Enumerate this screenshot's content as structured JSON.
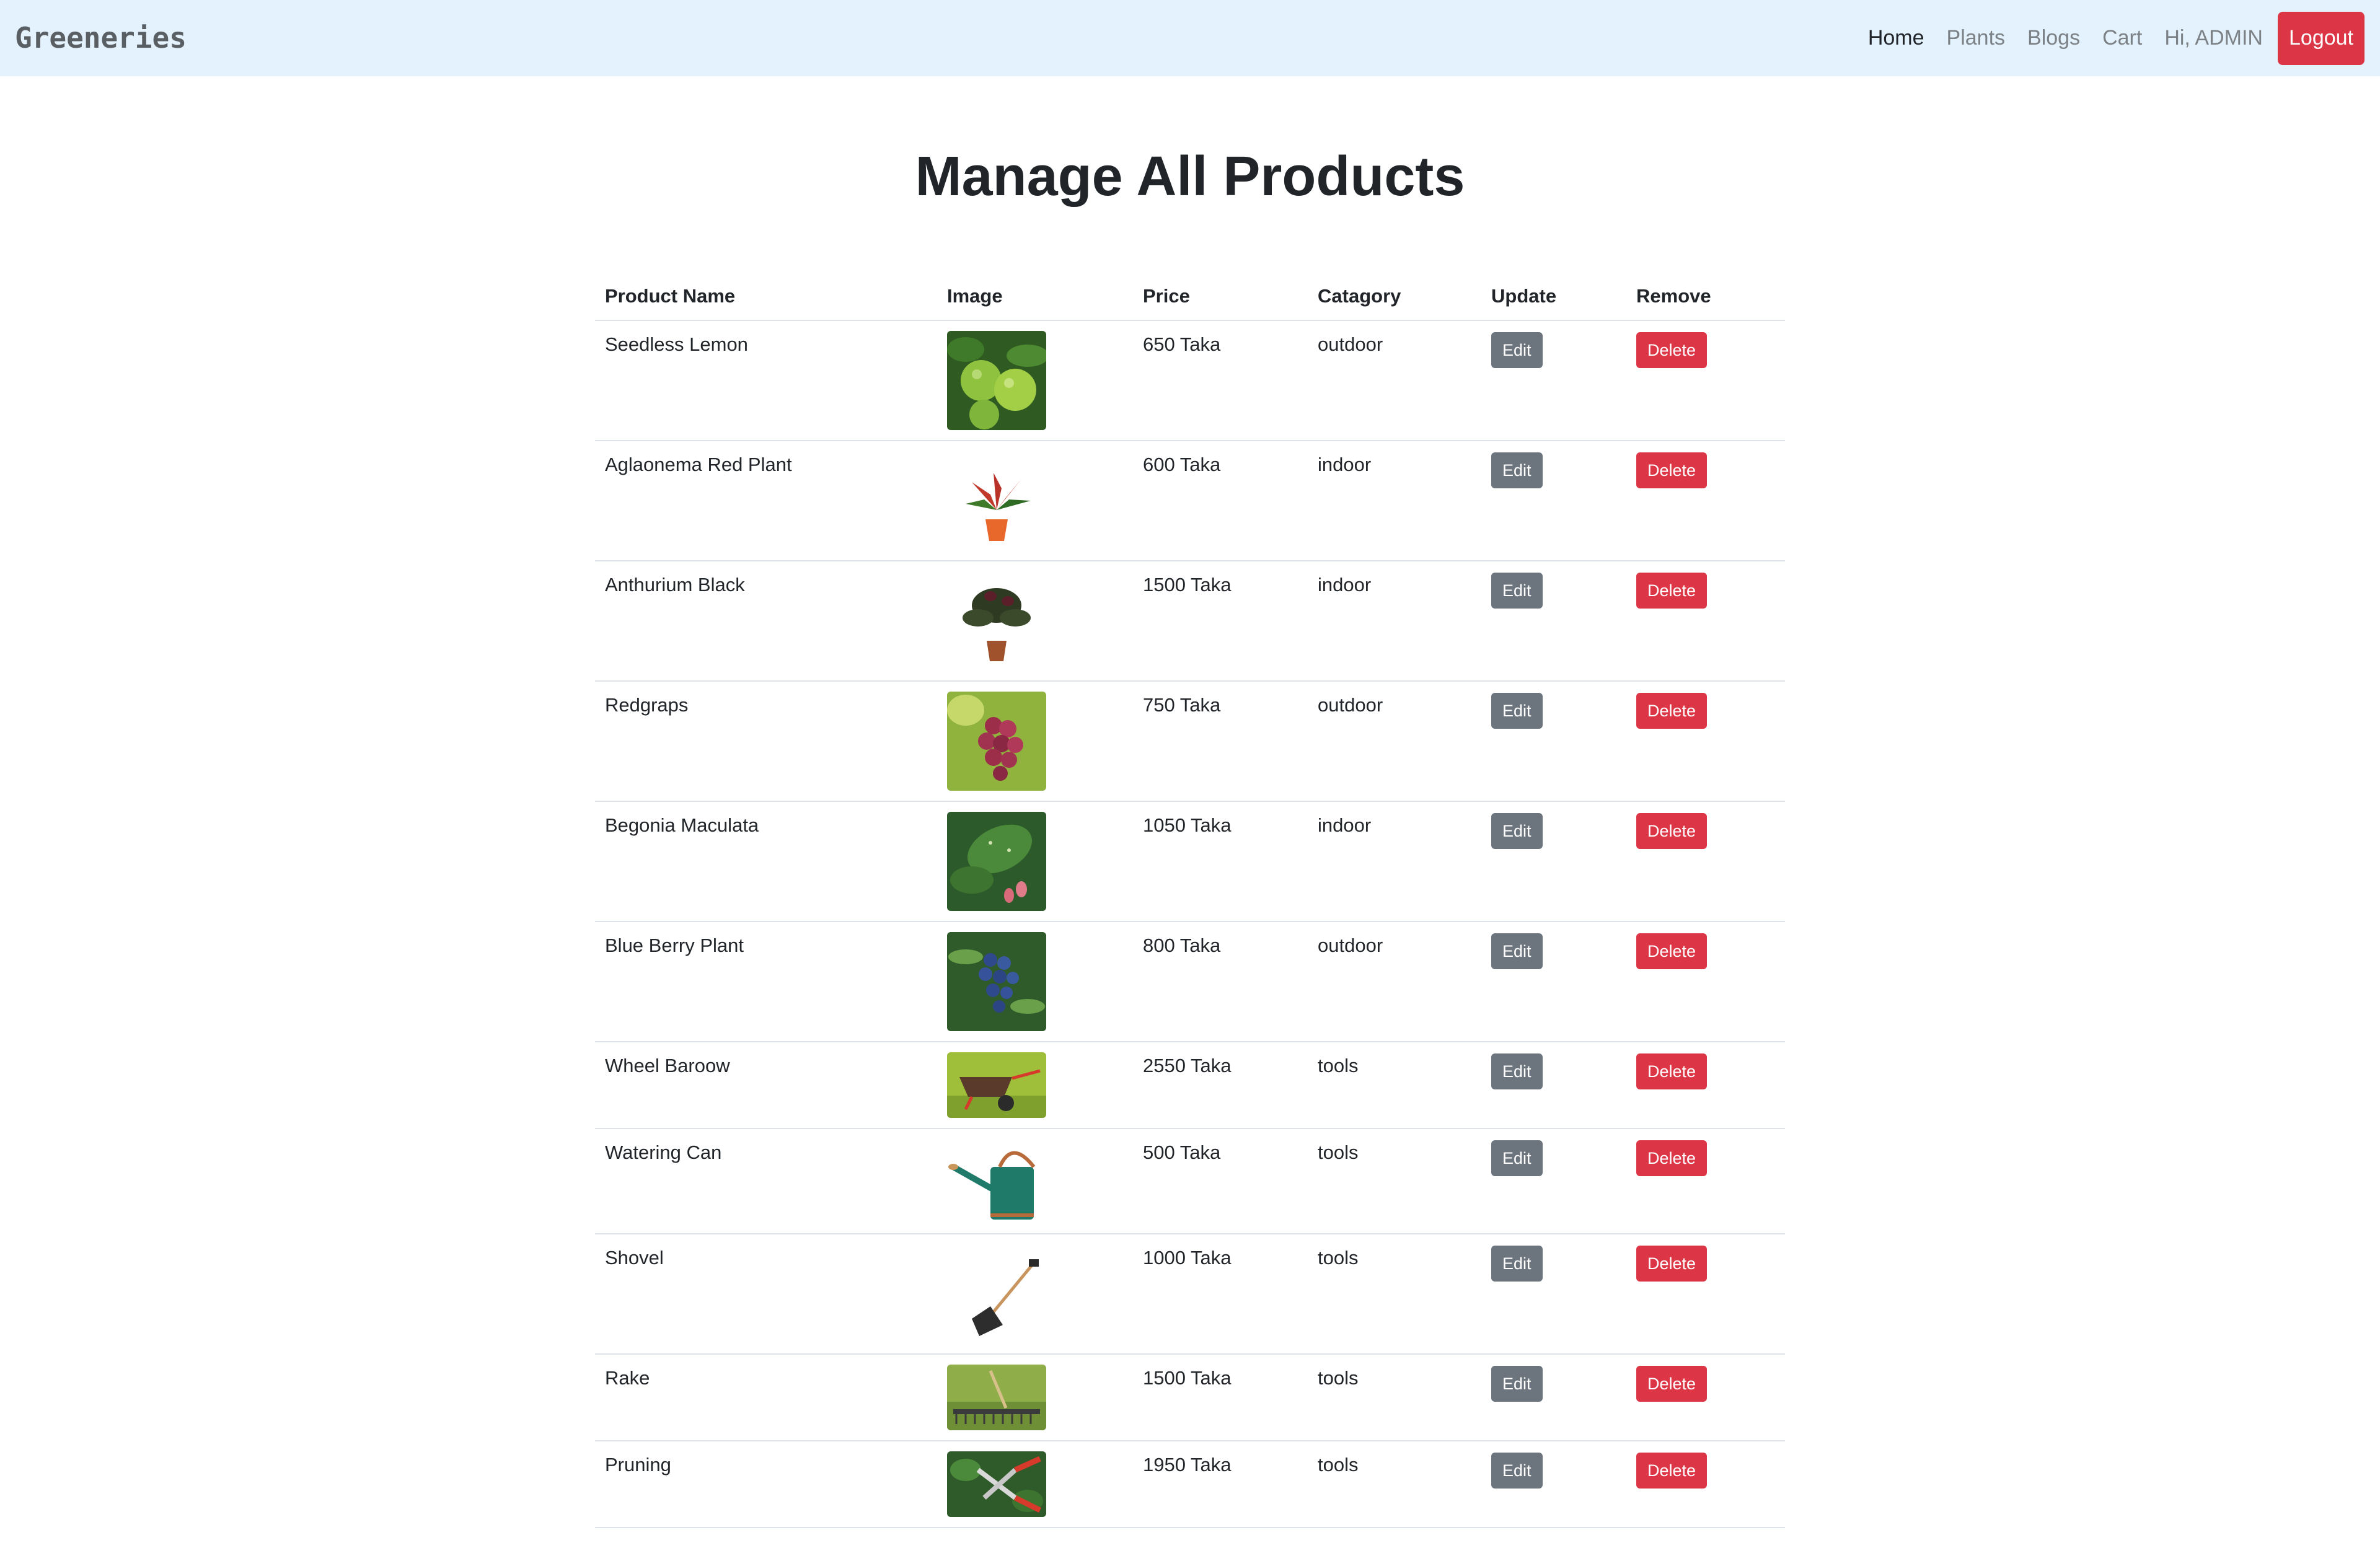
{
  "navbar": {
    "brand": "Greeneries",
    "links": [
      "Home",
      "Plants",
      "Blogs",
      "Cart",
      "Hi, ADMIN"
    ],
    "logout_label": "Logout"
  },
  "page": {
    "title": "Manage All Products"
  },
  "table": {
    "headers": [
      "Product Name",
      "Image",
      "Price",
      "Catagory",
      "Update",
      "Remove"
    ],
    "edit_label": "Edit",
    "delete_label": "Delete",
    "rows": [
      {
        "name": "Seedless Lemon",
        "price": "650 Taka",
        "category": "outdoor",
        "image": "lemon-image"
      },
      {
        "name": "Aglaonema Red Plant",
        "price": "600 Taka",
        "category": "indoor",
        "image": "aglaonema-image"
      },
      {
        "name": "Anthurium Black",
        "price": "1500 Taka",
        "category": "indoor",
        "image": "anthurium-image"
      },
      {
        "name": "Redgraps",
        "price": "750 Taka",
        "category": "outdoor",
        "image": "grapes-image"
      },
      {
        "name": "Begonia Maculata",
        "price": "1050 Taka",
        "category": "indoor",
        "image": "begonia-image"
      },
      {
        "name": "Blue Berry Plant",
        "price": "800 Taka",
        "category": "outdoor",
        "image": "blueberry-image"
      },
      {
        "name": "Wheel Baroow",
        "price": "2550 Taka",
        "category": "tools",
        "image": "wheelbarrow-image"
      },
      {
        "name": "Watering Can",
        "price": "500 Taka",
        "category": "tools",
        "image": "watering-can-image"
      },
      {
        "name": "Shovel",
        "price": "1000 Taka",
        "category": "tools",
        "image": "shovel-image"
      },
      {
        "name": "Rake",
        "price": "1500 Taka",
        "category": "tools",
        "image": "rake-image"
      },
      {
        "name": "Pruning",
        "price": "1950 Taka",
        "category": "tools",
        "image": "pruning-image"
      }
    ]
  },
  "colors": {
    "navbar_bg": "#e3f2fd",
    "edit_button": "#6c757d",
    "delete_button": "#dc3545"
  }
}
